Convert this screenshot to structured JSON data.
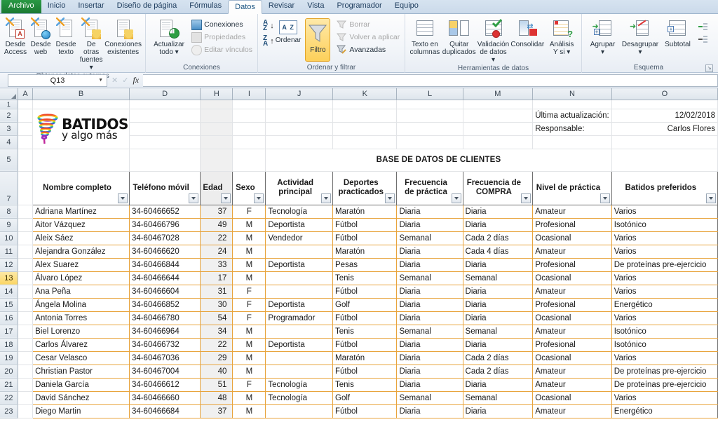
{
  "ribbon": {
    "tabs": [
      {
        "label": "Archivo",
        "kind": "file"
      },
      {
        "label": "Inicio",
        "kind": "normal"
      },
      {
        "label": "Insertar",
        "kind": "normal"
      },
      {
        "label": "Diseño de página",
        "kind": "normal"
      },
      {
        "label": "Fórmulas",
        "kind": "normal"
      },
      {
        "label": "Datos",
        "kind": "active"
      },
      {
        "label": "Revisar",
        "kind": "normal"
      },
      {
        "label": "Vista",
        "kind": "normal"
      },
      {
        "label": "Programador",
        "kind": "normal"
      },
      {
        "label": "Equipo",
        "kind": "normal"
      }
    ],
    "groups": [
      {
        "name": "Obtener datos externos",
        "buttons": [
          {
            "label": "Desde\nAccess",
            "icon": "access-doc-icon"
          },
          {
            "label": "Desde\nweb",
            "icon": "web-doc-icon"
          },
          {
            "label": "Desde\ntexto",
            "icon": "text-doc-icon"
          },
          {
            "label": "De otras\nfuentes ▾",
            "icon": "other-sources-icon"
          },
          {
            "label": "Conexiones\nexistentes",
            "icon": "existing-connections-icon"
          }
        ]
      },
      {
        "name": "Conexiones",
        "big": [
          {
            "label": "Actualizar\ntodo ▾",
            "icon": "refresh-all-icon"
          }
        ],
        "small": [
          {
            "label": "Conexiones",
            "icon": "connections-icon",
            "disabled": false
          },
          {
            "label": "Propiedades",
            "icon": "properties-icon",
            "disabled": true
          },
          {
            "label": "Editar vínculos",
            "icon": "edit-links-icon",
            "disabled": true
          }
        ]
      },
      {
        "name": "Ordenar y filtrar",
        "sort_az": "A→Z",
        "sort_za": "Z→A",
        "sort_label": "Ordenar",
        "filter_label": "Filtro",
        "filter_active": true,
        "small": [
          {
            "label": "Borrar",
            "icon": "clear-filter-icon",
            "disabled": true
          },
          {
            "label": "Volver a aplicar",
            "icon": "reapply-icon",
            "disabled": true
          },
          {
            "label": "Avanzadas",
            "icon": "advanced-filter-icon",
            "disabled": false
          }
        ]
      },
      {
        "name": "Herramientas de datos",
        "buttons": [
          {
            "label": "Texto en\ncolumnas",
            "icon": "text-to-columns-icon"
          },
          {
            "label": "Quitar\nduplicados",
            "icon": "remove-duplicates-icon"
          },
          {
            "label": "Validación\nde datos ▾",
            "icon": "data-validation-icon"
          },
          {
            "label": "Consolidar",
            "icon": "consolidate-icon"
          },
          {
            "label": "Análisis\nY si ▾",
            "icon": "what-if-analysis-icon"
          }
        ]
      },
      {
        "name": "Esquema",
        "buttons": [
          {
            "label": "Agrupar\n▾",
            "icon": "group-icon"
          },
          {
            "label": "Desagrupar\n▾",
            "icon": "ungroup-icon"
          },
          {
            "label": "Subtotal",
            "icon": "subtotal-icon"
          }
        ],
        "small": [
          {
            "label": "",
            "icon": "show-detail-icon",
            "disabled": false
          },
          {
            "label": "",
            "icon": "hide-detail-icon",
            "disabled": false
          }
        ],
        "dialog_launcher": "↘"
      }
    ]
  },
  "formula_bar": {
    "name_box": "Q13",
    "fx_label": "fx",
    "formula_value": ""
  },
  "sheet": {
    "columns": [
      "A",
      "B",
      "D",
      "H",
      "I",
      "J",
      "K",
      "L",
      "M",
      "N",
      "O"
    ],
    "row_numbers": [
      "1",
      "2",
      "3",
      "4",
      "5",
      "7",
      "8",
      "9",
      "10",
      "11",
      "12",
      "13",
      "14",
      "15",
      "16",
      "17",
      "18",
      "19",
      "20",
      "21",
      "22",
      "23"
    ],
    "selected_row": "13",
    "selected_column": "H",
    "logo": {
      "line1": "BATIDOS",
      "line2": "y algo más"
    },
    "meta": {
      "updated_label": "Última actualización:",
      "updated_value": "12/02/2018",
      "owner_label": "Responsable:",
      "owner_value": "Carlos Flores"
    },
    "title": "BASE DE DATOS DE CLIENTES",
    "title_color": "#C00000",
    "headers": [
      "Nombre completo",
      "Teléfono móvil",
      "Edad",
      "Sexo",
      "Actividad principal",
      "Deportes practicados",
      "Frecuencia de práctica",
      "Frecuencia de COMPRA",
      "Nivel de práctica",
      "Batidos preferidos"
    ],
    "rows": [
      {
        "n": "8",
        "nombre": "Adriana Martínez",
        "telefono": "34-60466652",
        "edad": "37",
        "sexo": "F",
        "actividad": "Tecnología",
        "deporte": "Maratón",
        "frec_practica": "Diaria",
        "frec_compra": "Diaria",
        "nivel": "Amateur",
        "batido": "Varios"
      },
      {
        "n": "9",
        "nombre": "Aitor Vázquez",
        "telefono": "34-60466796",
        "edad": "49",
        "sexo": "M",
        "actividad": "Deportista",
        "deporte": "Fútbol",
        "frec_practica": "Diaria",
        "frec_compra": "Diaria",
        "nivel": "Profesional",
        "batido": "Isotónico"
      },
      {
        "n": "10",
        "nombre": "Aleix Sáez",
        "telefono": "34-60467028",
        "edad": "22",
        "sexo": "M",
        "actividad": "Vendedor",
        "deporte": "Fútbol",
        "frec_practica": "Semanal",
        "frec_compra": "Cada 2 días",
        "nivel": "Ocasional",
        "batido": "Varios"
      },
      {
        "n": "11",
        "nombre": "Alejandra González",
        "telefono": "34-60466620",
        "edad": "24",
        "sexo": "M",
        "actividad": "",
        "deporte": "Maratón",
        "frec_practica": "Diaria",
        "frec_compra": "Cada 4 días",
        "nivel": "Amateur",
        "batido": "Varios"
      },
      {
        "n": "12",
        "nombre": "Alex Suarez",
        "telefono": "34-60466844",
        "edad": "33",
        "sexo": "M",
        "actividad": "Deportista",
        "deporte": "Pesas",
        "frec_practica": "Diaria",
        "frec_compra": "Diaria",
        "nivel": "Profesional",
        "batido": "De proteínas pre-ejercicio"
      },
      {
        "n": "13",
        "nombre": "Álvaro López",
        "telefono": "34-60466644",
        "edad": "17",
        "sexo": "M",
        "actividad": "",
        "deporte": "Tenis",
        "frec_practica": "Semanal",
        "frec_compra": "Semanal",
        "nivel": "Ocasional",
        "batido": "Varios"
      },
      {
        "n": "14",
        "nombre": "Ana Peña",
        "telefono": "34-60466604",
        "edad": "31",
        "sexo": "F",
        "actividad": "",
        "deporte": "Fútbol",
        "frec_practica": "Diaria",
        "frec_compra": "Diaria",
        "nivel": "Amateur",
        "batido": "Varios"
      },
      {
        "n": "15",
        "nombre": "Ángela Molina",
        "telefono": "34-60466852",
        "edad": "30",
        "sexo": "F",
        "actividad": "Deportista",
        "deporte": "Golf",
        "frec_practica": "Diaria",
        "frec_compra": "Diaria",
        "nivel": "Profesional",
        "batido": "Energético"
      },
      {
        "n": "16",
        "nombre": "Antonia Torres",
        "telefono": "34-60466780",
        "edad": "54",
        "sexo": "F",
        "actividad": "Programador",
        "deporte": "Fútbol",
        "frec_practica": "Diaria",
        "frec_compra": "Diaria",
        "nivel": "Ocasional",
        "batido": "Varios"
      },
      {
        "n": "17",
        "nombre": "Biel Lorenzo",
        "telefono": "34-60466964",
        "edad": "34",
        "sexo": "M",
        "actividad": "",
        "deporte": "Tenis",
        "frec_practica": "Semanal",
        "frec_compra": "Semanal",
        "nivel": "Amateur",
        "batido": "Isotónico"
      },
      {
        "n": "18",
        "nombre": "Carlos Álvarez",
        "telefono": "34-60466732",
        "edad": "22",
        "sexo": "M",
        "actividad": "Deportista",
        "deporte": "Fútbol",
        "frec_practica": "Diaria",
        "frec_compra": "Diaria",
        "nivel": "Profesional",
        "batido": "Isotónico"
      },
      {
        "n": "19",
        "nombre": "Cesar Velasco",
        "telefono": "34-60467036",
        "edad": "29",
        "sexo": "M",
        "actividad": "",
        "deporte": "Maratón",
        "frec_practica": "Diaria",
        "frec_compra": "Cada 2 días",
        "nivel": "Ocasional",
        "batido": "Varios"
      },
      {
        "n": "20",
        "nombre": "Christian Pastor",
        "telefono": "34-60467004",
        "edad": "40",
        "sexo": "M",
        "actividad": "",
        "deporte": "Fútbol",
        "frec_practica": "Diaria",
        "frec_compra": "Cada 2 días",
        "nivel": "Amateur",
        "batido": "De proteínas pre-ejercicio"
      },
      {
        "n": "21",
        "nombre": "Daniela García",
        "telefono": "34-60466612",
        "edad": "51",
        "sexo": "F",
        "actividad": "Tecnología",
        "deporte": "Tenis",
        "frec_practica": "Diaria",
        "frec_compra": "Diaria",
        "nivel": "Amateur",
        "batido": "De proteínas pre-ejercicio"
      },
      {
        "n": "22",
        "nombre": "David Sánchez",
        "telefono": "34-60466660",
        "edad": "48",
        "sexo": "M",
        "actividad": "Tecnología",
        "deporte": "Golf",
        "frec_practica": "Semanal",
        "frec_compra": "Semanal",
        "nivel": "Ocasional",
        "batido": "Varios"
      },
      {
        "n": "23",
        "nombre": "Diego Martin",
        "telefono": "34-60466684",
        "edad": "37",
        "sexo": "M",
        "actividad": "",
        "deporte": "Fútbol",
        "frec_practica": "Diaria",
        "frec_compra": "Diaria",
        "nivel": "Amateur",
        "batido": "Energético"
      }
    ]
  }
}
